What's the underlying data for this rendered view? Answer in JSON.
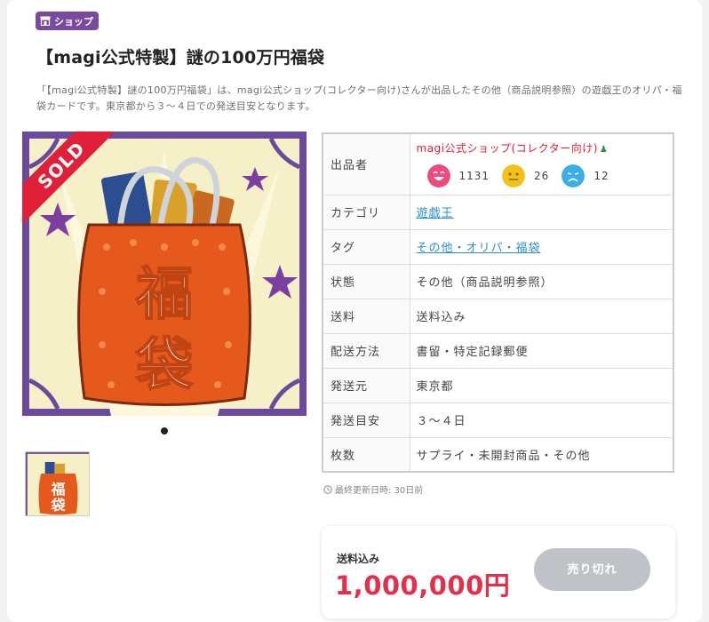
{
  "badge": {
    "label": "ショップ",
    "icon": "shop-icon"
  },
  "title": "【magi公式特製】謎の100万円福袋",
  "description": "「【magi公式特製】謎の100万円福袋」は、magi公式ショップ(コレクター向け)さんが出品したその他（商品説明参照）の遊戯王のオリパ・福袋カードです。東京都から３〜４日での発送目安となります。",
  "image": {
    "sold_label": "SOLD",
    "image_count": 1,
    "product_lettering": "福袋"
  },
  "details": {
    "seller_label": "出品者",
    "seller_name": "magi公式ショップ(コレクター向け)",
    "ratings": {
      "good": "1131",
      "normal": "26",
      "bad": "12"
    },
    "rows": [
      {
        "label": "カテゴリ",
        "value": "遊戯王",
        "link": true
      },
      {
        "label": "タグ",
        "value": "その他・オリパ・福袋",
        "link": true
      },
      {
        "label": "状態",
        "value": "その他（商品説明参照）",
        "link": false
      },
      {
        "label": "送料",
        "value": "送料込み",
        "link": false
      },
      {
        "label": "配送方法",
        "value": "書留・特定記録郵便",
        "link": false
      },
      {
        "label": "発送元",
        "value": "東京都",
        "link": false
      },
      {
        "label": "発送目安",
        "value": "３〜４日",
        "link": false
      },
      {
        "label": "枚数",
        "value": "サプライ・未開封商品・その他",
        "link": false
      }
    ]
  },
  "updated": "最終更新日時: 30日前",
  "purchase": {
    "shipping_label": "送料込み",
    "price": "1,000,000円",
    "button_label": "売り切れ"
  },
  "colors": {
    "brand_purple": "#7a4a9e",
    "accent_red": "#e0203a",
    "link_blue": "#2a8fd0",
    "disabled_gray": "#bfc3c8"
  }
}
